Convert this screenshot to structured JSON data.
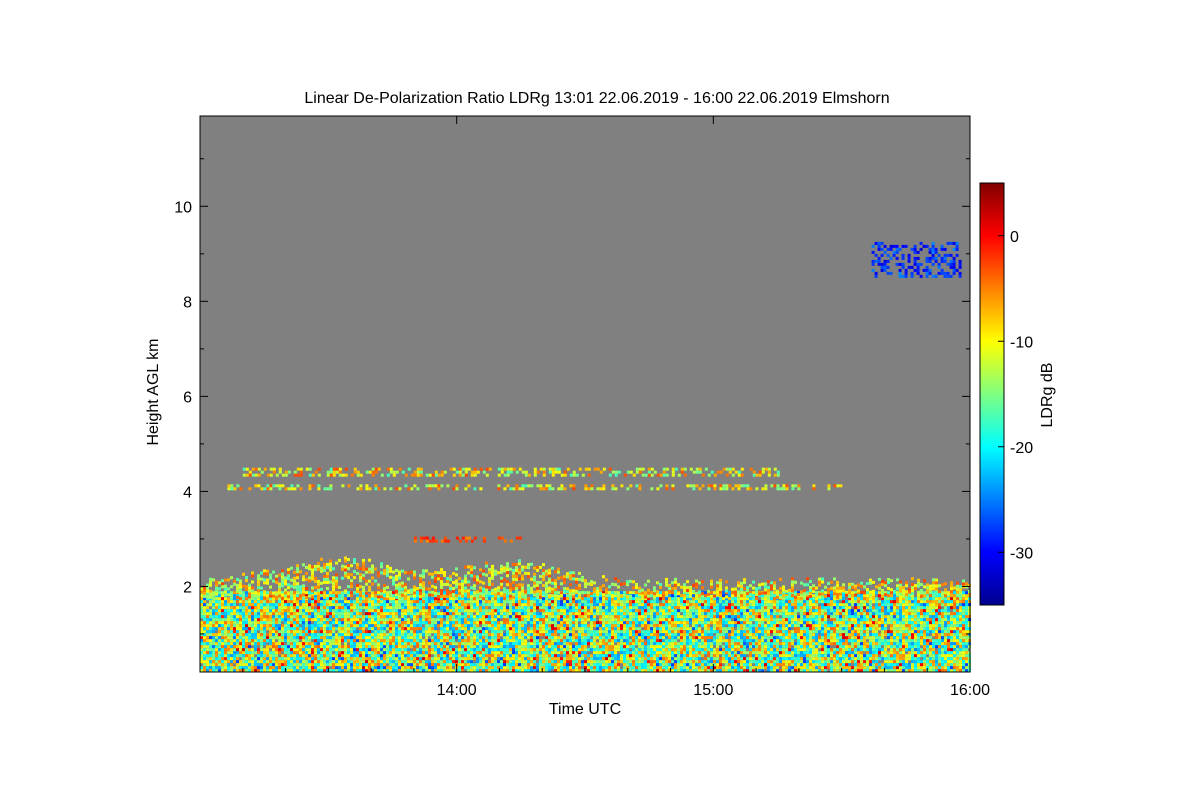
{
  "chart_data": {
    "type": "heatmap",
    "title": "Linear De-Polarization Ratio LDRg   13:01 22.06.2019 - 16:00 22.06.2019 Elmshorn",
    "xlabel": "Time UTC",
    "ylabel": "Height AGL km",
    "colorbar_label": "LDRg dB",
    "x_range": [
      "13:00",
      "16:00"
    ],
    "x_ticks": [
      "14:00",
      "15:00",
      "16:00"
    ],
    "y_range": [
      0.2,
      11.9
    ],
    "y_ticks": [
      2,
      4,
      6,
      8,
      10
    ],
    "colorbar_range": [
      -35,
      5
    ],
    "colorbar_ticks": [
      0,
      -10,
      -20,
      -30
    ],
    "colormap": "jet",
    "no_data_color": "#808080",
    "features": [
      {
        "name": "boundary layer",
        "time_start": "13:00",
        "time_end": "16:00",
        "height_bottom_km": 0.25,
        "height_top_km": 1.9,
        "ldr_db_range": [
          -25,
          -5
        ],
        "typical_ldr_db": -14
      },
      {
        "name": "upper boundary layer fringe",
        "time_start": "13:00",
        "time_end": "16:00",
        "height_bottom_km": 1.8,
        "height_top_km": 2.55,
        "ldr_db_range": [
          -20,
          -5
        ],
        "typical_ldr_db": -10
      },
      {
        "name": "layer ~4.1 km",
        "time_start": "13:05",
        "time_end": "15:30",
        "height_bottom_km": 4.05,
        "height_top_km": 4.15,
        "ldr_db_range": [
          -20,
          -5
        ],
        "typical_ldr_db": -10
      },
      {
        "name": "layer ~4.4 km",
        "time_start": "13:10",
        "time_end": "15:15",
        "height_bottom_km": 4.35,
        "height_top_km": 4.5,
        "ldr_db_range": [
          -20,
          -5
        ],
        "typical_ldr_db": -10
      },
      {
        "name": "layer ~3.0 km",
        "time_start": "13:50",
        "time_end": "14:15",
        "height_bottom_km": 2.95,
        "height_top_km": 3.05,
        "ldr_db_range": [
          -5,
          0
        ],
        "typical_ldr_db": -3
      },
      {
        "name": "ice cloud ~8.8 km",
        "time_start": "15:37",
        "time_end": "15:58",
        "height_bottom_km": 8.5,
        "height_top_km": 9.25,
        "ldr_db_range": [
          -32,
          -25
        ],
        "typical_ldr_db": -28
      }
    ]
  }
}
